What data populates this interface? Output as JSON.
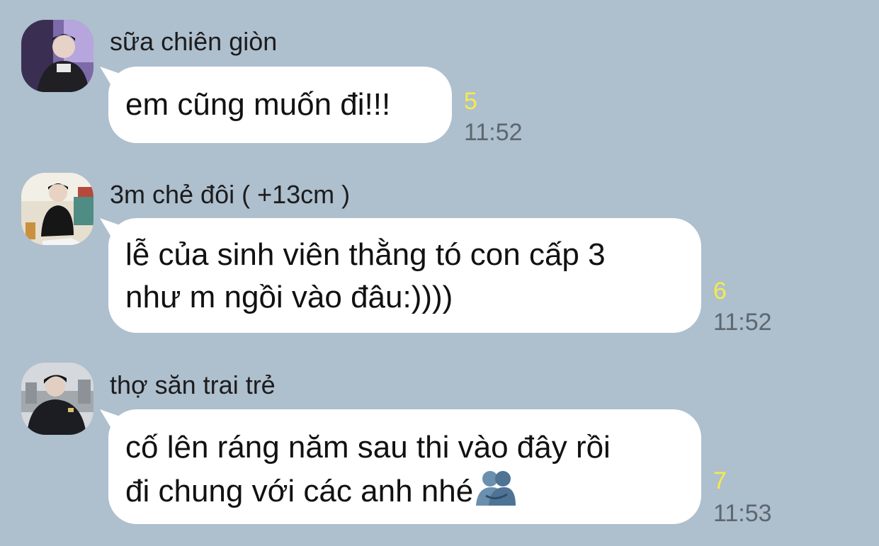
{
  "messages": [
    {
      "sender": "sữa chiên giòn",
      "avatar": "avatar-purple-gamer",
      "lines": [
        "em cũng muốn đi!!!"
      ],
      "read_count": "5",
      "time": "11:52"
    },
    {
      "sender": "3m chẻ đôi ( +13cm )",
      "avatar": "avatar-sitting-boy",
      "lines": [
        "lễ của sinh viên thằng tó con cấp 3",
        "như m ngồi vào đâu:))))"
      ],
      "read_count": "6",
      "time": "11:52"
    },
    {
      "sender": "thợ săn trai trẻ",
      "avatar": "avatar-street-boy",
      "lines": [
        "cố lên ráng năm sau thi vào đây rồi",
        "đi chung với các anh nhé"
      ],
      "trailing_emoji": "people-hugging-icon",
      "read_count": "7",
      "time": "11:53"
    }
  ],
  "colors": {
    "background": "#aebfcd",
    "bubble": "#ffffff",
    "read_count": "#f6ea4c",
    "time": "#5d6770"
  }
}
